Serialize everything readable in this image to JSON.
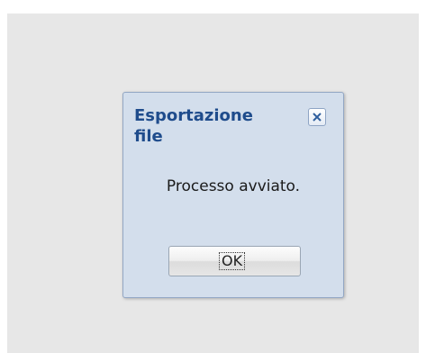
{
  "dialog": {
    "title": "Esportazione file",
    "message": "Processo avviato.",
    "ok_label": "OK",
    "close_icon": "close-icon"
  },
  "colors": {
    "backdrop": "#e7e7e7",
    "dialog_background": "#d3deec",
    "dialog_border": "#93a7c4",
    "title_text": "#1f4c8c"
  }
}
